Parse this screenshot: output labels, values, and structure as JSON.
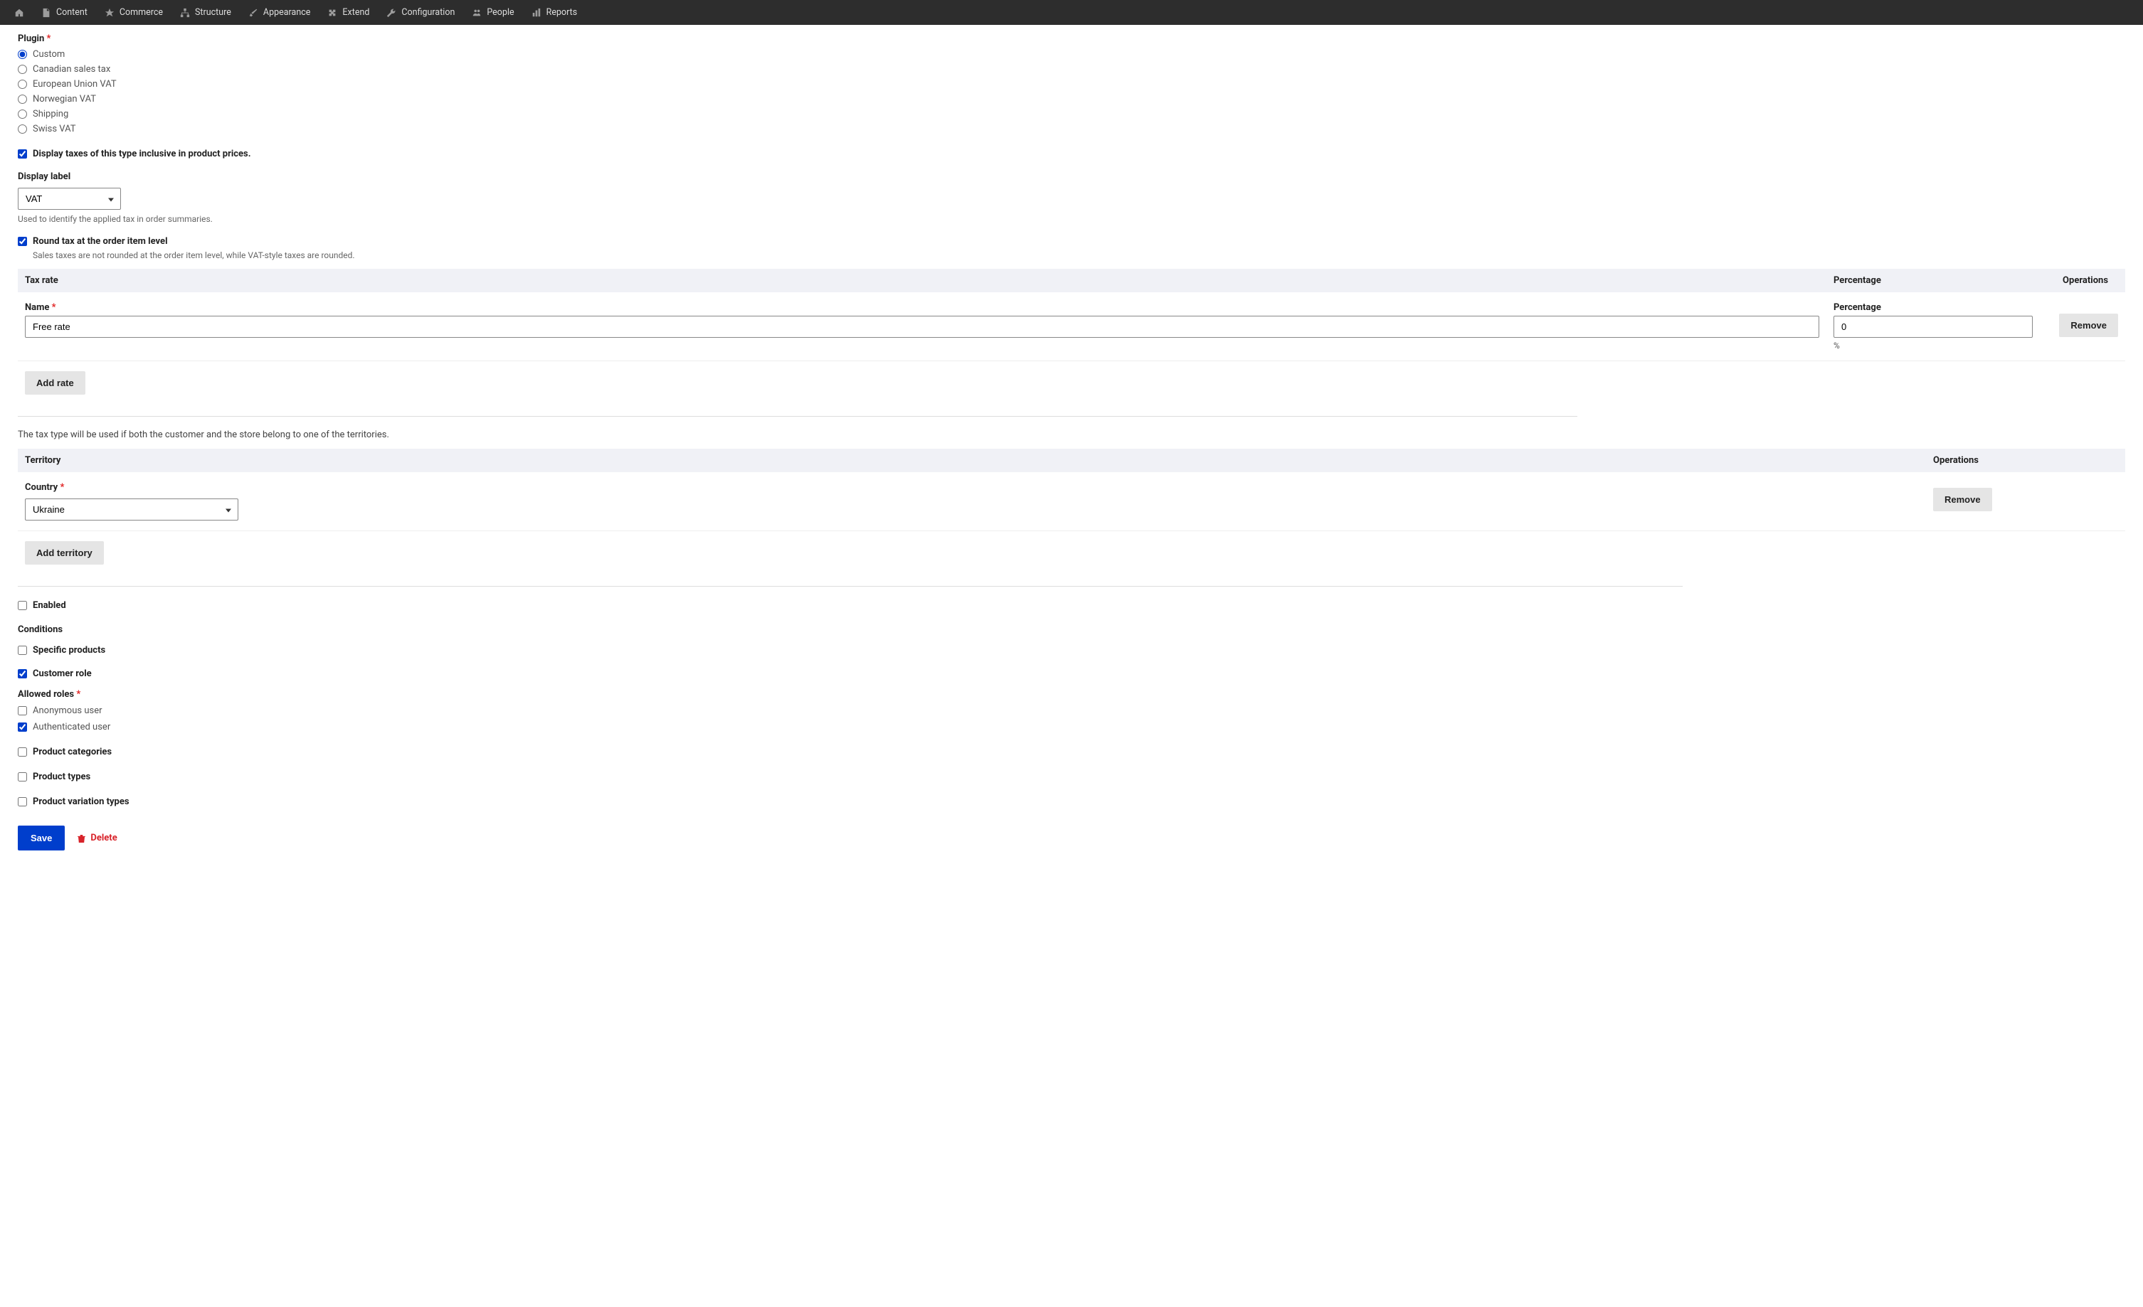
{
  "toolbar": [
    {
      "label": "",
      "icon": "home"
    },
    {
      "label": "Content",
      "icon": "doc"
    },
    {
      "label": "Commerce",
      "icon": "star"
    },
    {
      "label": "Structure",
      "icon": "tree"
    },
    {
      "label": "Appearance",
      "icon": "brush"
    },
    {
      "label": "Extend",
      "icon": "puzzle"
    },
    {
      "label": "Configuration",
      "icon": "wrench"
    },
    {
      "label": "People",
      "icon": "people"
    },
    {
      "label": "Reports",
      "icon": "chart"
    }
  ],
  "plugin": {
    "label": "Plugin",
    "options": [
      "Custom",
      "Canadian sales tax",
      "European Union VAT",
      "Norwegian VAT",
      "Shipping",
      "Swiss VAT"
    ],
    "selected": "Custom"
  },
  "display_inclusive": {
    "label": "Display taxes of this type inclusive in product prices.",
    "checked": true
  },
  "display_label": {
    "label": "Display label",
    "value": "VAT",
    "help": "Used to identify the applied tax in order summaries."
  },
  "round_tax": {
    "label": "Round tax at the order item level",
    "help": "Sales taxes are not rounded at the order item level, while VAT-style taxes are rounded.",
    "checked": true
  },
  "tax_rate_table": {
    "headers": [
      "Tax rate",
      "Percentage",
      "Operations"
    ],
    "row": {
      "name_label": "Name",
      "name_value": "Free rate",
      "pct_label": "Percentage",
      "pct_value": "0",
      "pct_suffix": "%",
      "remove": "Remove"
    },
    "add": "Add rate"
  },
  "territory_help": "The tax type will be used if both the customer and the store belong to one of the territories.",
  "territory_table": {
    "headers": [
      "Territory",
      "Operations"
    ],
    "row": {
      "country_label": "Country",
      "country_value": "Ukraine",
      "remove": "Remove"
    },
    "add": "Add territory"
  },
  "enabled": {
    "label": "Enabled",
    "checked": false
  },
  "conditions": {
    "label": "Conditions",
    "specific_products": {
      "label": "Specific products",
      "checked": false
    },
    "customer_role": {
      "label": "Customer role",
      "checked": true
    },
    "allowed_roles": {
      "label": "Allowed roles",
      "anonymous": {
        "label": "Anonymous user",
        "checked": false
      },
      "authenticated": {
        "label": "Authenticated user",
        "checked": true
      }
    },
    "product_categories": {
      "label": "Product categories",
      "checked": false
    },
    "product_types": {
      "label": "Product types",
      "checked": false
    },
    "product_variation_types": {
      "label": "Product variation types",
      "checked": false
    }
  },
  "actions": {
    "save": "Save",
    "delete": "Delete"
  }
}
